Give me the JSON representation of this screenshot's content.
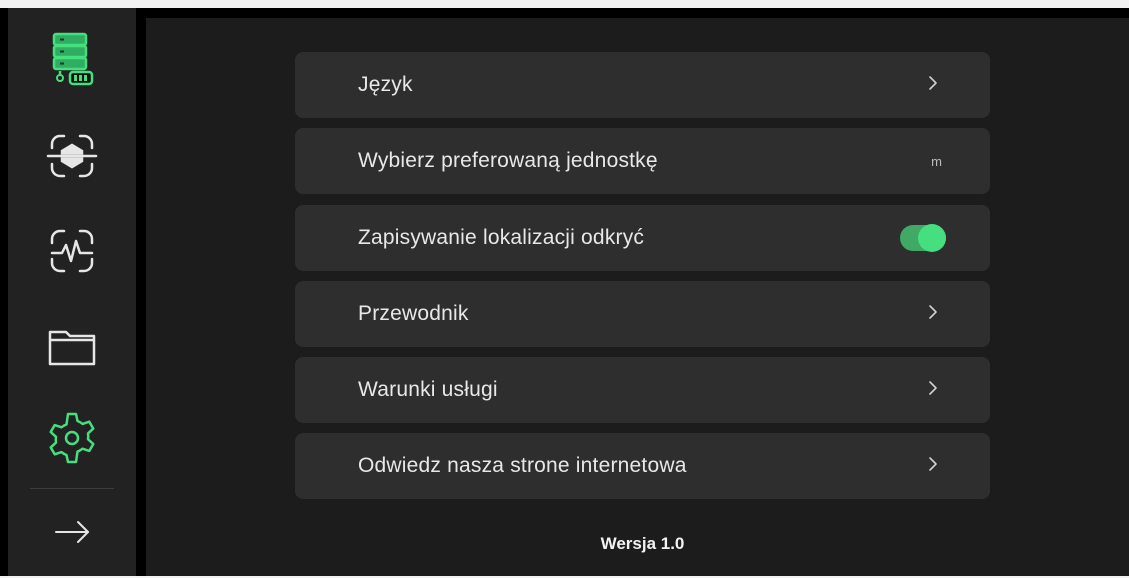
{
  "sidebar": {
    "items": [
      {
        "icon": "server-battery-icon",
        "active": true
      },
      {
        "icon": "scan-object-icon",
        "active": false
      },
      {
        "icon": "scan-signal-icon",
        "active": false
      },
      {
        "icon": "folder-icon",
        "active": false
      },
      {
        "icon": "gear-icon",
        "active": true
      }
    ],
    "exit_icon": "arrow-right-icon"
  },
  "settings": {
    "language_label": "Język",
    "unit_label": "Wybierz preferowaną jednostkę",
    "unit_value": "m",
    "location_label": "Zapisywanie lokalizacji odkryć",
    "location_enabled": true,
    "guide_label": "Przewodnik",
    "terms_label": "Warunki usługi",
    "website_label": "Odwiedz nasza strone internetowa"
  },
  "footer": {
    "version": "Wersja 1.0"
  },
  "colors": {
    "accent": "#45df7f",
    "toggle_track": "#3fa965",
    "row_bg": "#2e2e2e",
    "main_bg": "#1c1c1c",
    "sidebar_bg": "#222222"
  }
}
